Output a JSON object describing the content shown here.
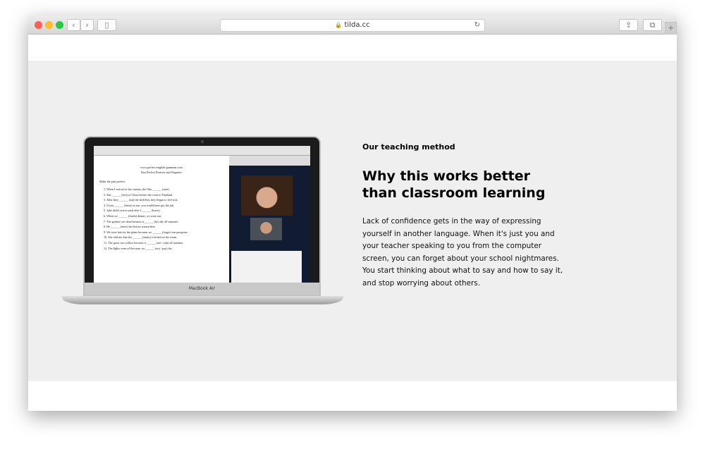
{
  "browser": {
    "url": "tilda.cc",
    "back": "‹",
    "forward": "›",
    "new_tab": "+"
  },
  "laptop": {
    "brand": "MacBook Air",
    "worksheet": {
      "site": "www.perfect-english-grammar.com",
      "title": "Past Perfect Positive and Negative",
      "instruction": "Make the past perfect:",
      "items": [
        "1. When I arrived at the cinema, the film ______ (start).",
        "2. She ______ (live) in China before she went to Thailand.",
        "3. After they ______ (eat) the shellfish, they began to feel sick.",
        "4. If you ______ (listen) to me, you would have got the job.",
        "5. Julie didn't arrive until after I ______ (leave).",
        "6. When we ______ (finish) dinner, we went out.",
        "7. The garden was dead because it ______ (be) dry all summer.",
        "8. He ______ (meet) her before somewhere.",
        "9. We were late for the plane because we ______ (forget) our passports.",
        "10. She told me that she ______ (study) a lot before the exam.",
        "11. The grass was yellow because it ______ (not / rain) all summer.",
        "12. The lights went off because we ______ (not / pay) the"
      ]
    }
  },
  "content": {
    "eyebrow": "Our teaching method",
    "heading": "Why this works better than classroom learning",
    "body": "Lack of confidence gets in the way of expressing yourself in another language. When it's just you and your teacher speaking to you from the computer screen, you can forget about your school nightmares. You start thinking about what to say and how to say it, and stop worrying about others."
  }
}
